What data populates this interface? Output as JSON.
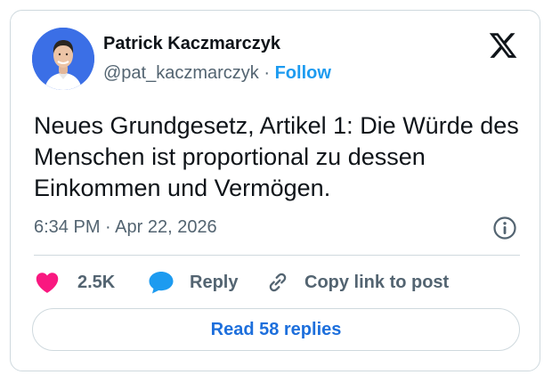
{
  "author": {
    "display_name": "Patrick Kaczmarczyk",
    "handle": "@pat_kaczmarczyk",
    "separator": "·",
    "follow_label": "Follow"
  },
  "tweet": {
    "text": "Neues Grundgesetz, Artikel 1: Die Würde des Menschen ist proportional zu dessen Einkommen und Vermögen.",
    "timestamp": "6:34 PM · Apr 22, 2026"
  },
  "actions": {
    "like_count": "2.5K",
    "reply_label": "Reply",
    "copy_label": "Copy link to post"
  },
  "read_replies_label": "Read 58 replies",
  "icons": {
    "like": "heart-icon",
    "reply": "speech-bubble-icon",
    "copy": "link-icon",
    "info": "info-icon",
    "brand": "x-logo-icon"
  },
  "colors": {
    "like": "#f91880",
    "reply": "#1d9bf0",
    "follow": "#1d9bf0",
    "read_replies": "#1d6fdc",
    "avatar_background": "#3b6fe6",
    "border": "#cfd9de"
  }
}
